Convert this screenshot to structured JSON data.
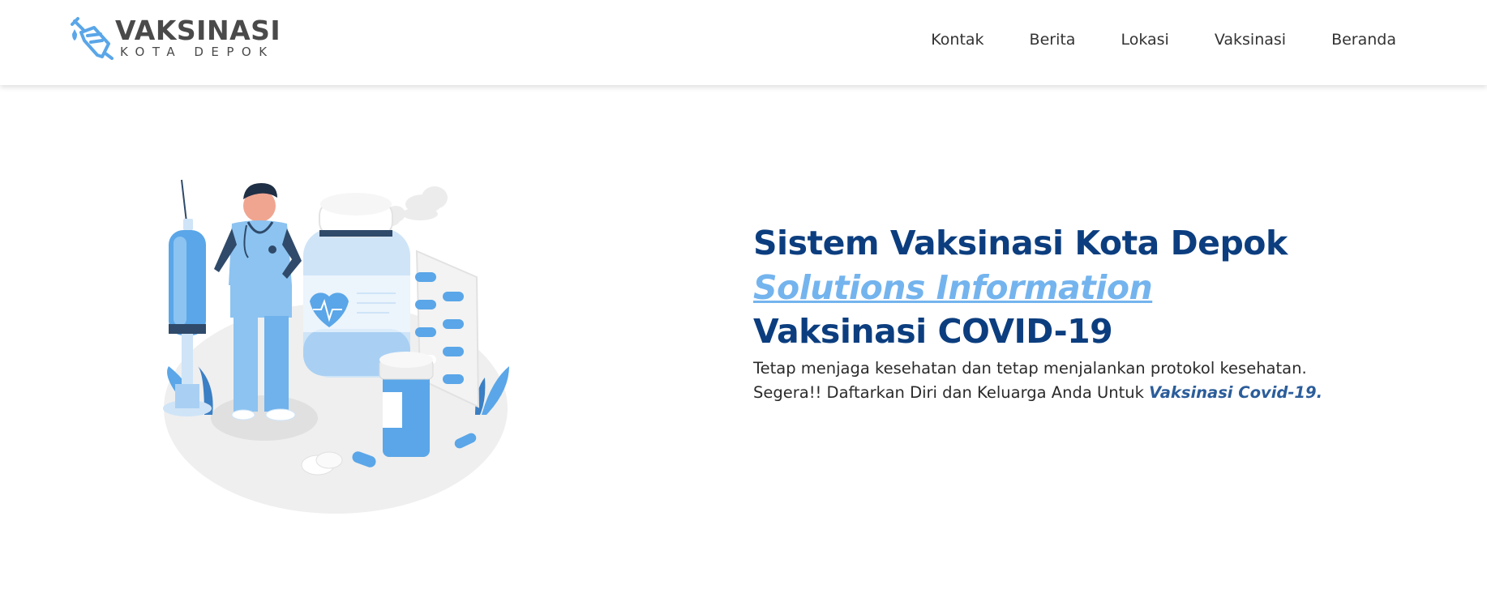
{
  "header": {
    "logo_title": "VAKSINASI",
    "logo_subtitle": "KOTA DEPOK",
    "nav": [
      {
        "label": "Kontak"
      },
      {
        "label": "Berita"
      },
      {
        "label": "Lokasi"
      },
      {
        "label": "Vaksinasi"
      },
      {
        "label": "Beranda"
      }
    ]
  },
  "hero": {
    "title": "Sistem Vaksinasi Kota Depok",
    "subtitle": "Solutions Information",
    "heading": "Vaksinasi COVID-19",
    "description": "Tetap menjaga kesehatan dan tetap menjalankan protokol kesehatan. Segera!! Daftarkan Diri dan Keluarga Anda Untuk ",
    "description_emphasis": "Vaksinasi Covid-19."
  },
  "illustration": {
    "icon": "doctor-vaccine-illustration",
    "colors": {
      "primary": "#5aa6e8",
      "light": "#cfe4f7",
      "dark": "#2f4a6a",
      "ground": "#efefef"
    }
  },
  "colors": {
    "title": "#0c3e7f",
    "accent": "#74b4ee",
    "emphasis": "#2b5d9a"
  }
}
